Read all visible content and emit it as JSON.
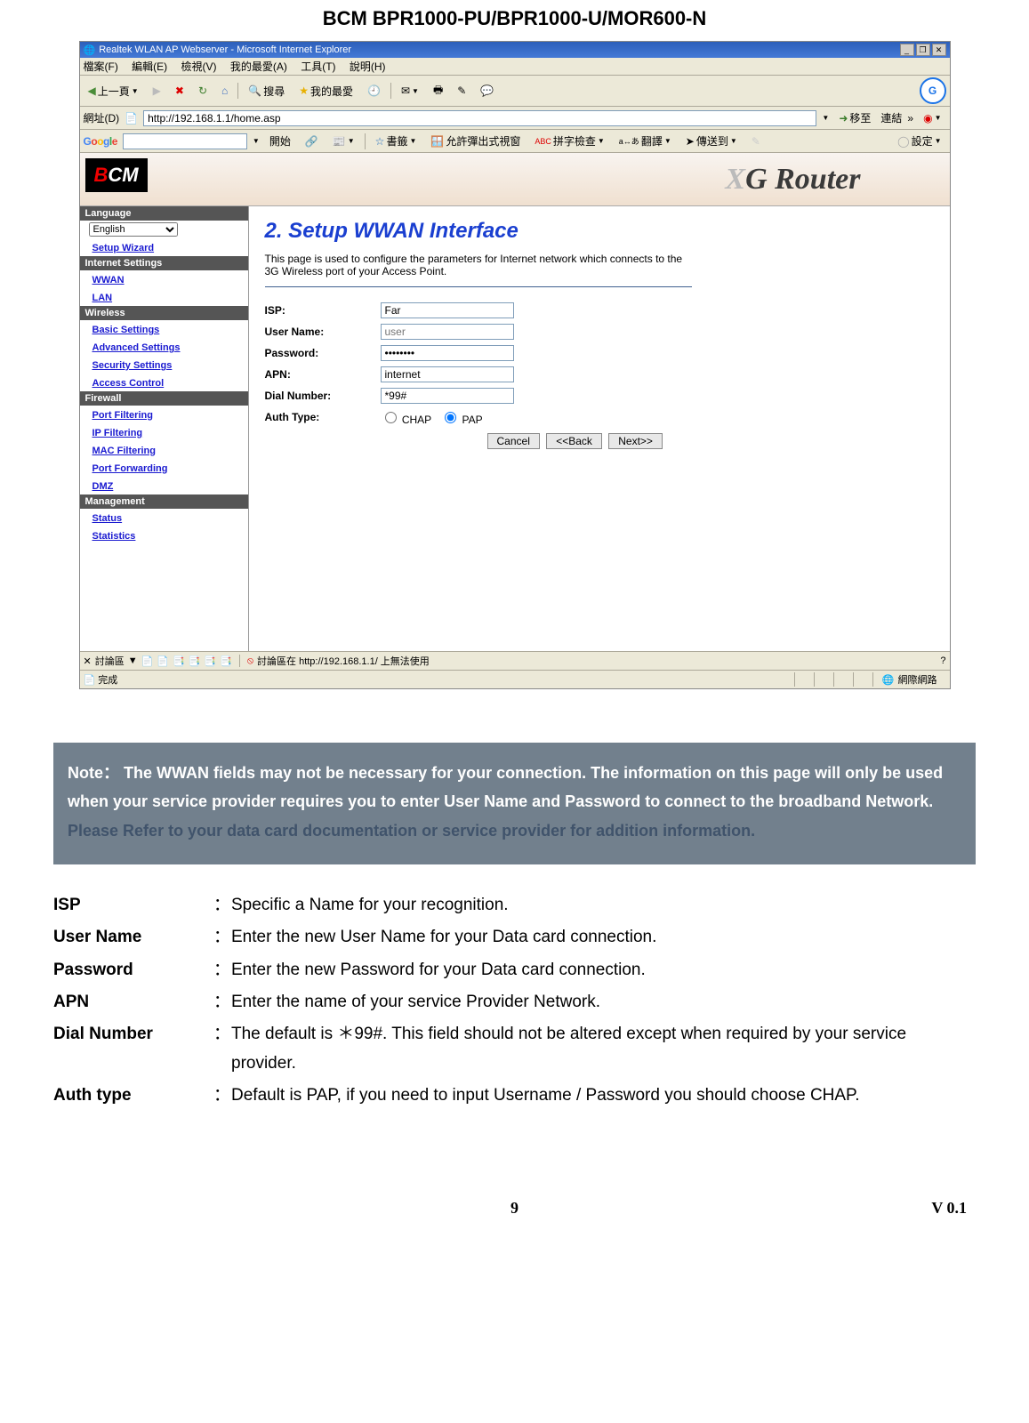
{
  "doc_title": "BCM    BPR1000-PU/BPR1000-U/MOR600-N",
  "browser": {
    "title": "Realtek WLAN AP Webserver - Microsoft Internet Explorer",
    "menus": [
      "檔案(F)",
      "編輯(E)",
      "檢視(V)",
      "我的最愛(A)",
      "工具(T)",
      "說明(H)"
    ],
    "toolbar": {
      "back": "上一頁",
      "search": "搜尋",
      "favorites": "我的最愛"
    },
    "address_label": "網址(D)",
    "address_value": "http://192.168.1.1/home.asp",
    "go": "移至",
    "links": "連結",
    "google": {
      "label": "Google",
      "start": "開始",
      "bookmarks": "書籤",
      "popup": "允許彈出式視窗",
      "spell": "拼字檢查",
      "translate": "翻譯",
      "sendto": "傳送到",
      "settings": "設定"
    }
  },
  "router": {
    "brand": "BCM",
    "banner": "XG Router",
    "sidebar": {
      "language_head": "Language",
      "language_value": "English",
      "setup_wizard": "Setup Wizard",
      "internet_head": "Internet Settings",
      "internet": [
        "WWAN",
        "LAN"
      ],
      "wireless_head": "Wireless",
      "wireless": [
        "Basic Settings",
        "Advanced Settings",
        "Security Settings",
        "Access Control"
      ],
      "firewall_head": "Firewall",
      "firewall": [
        "Port Filtering",
        "IP Filtering",
        "MAC Filtering",
        "Port Forwarding",
        "DMZ"
      ],
      "management_head": "Management",
      "management": [
        "Status",
        "Statistics"
      ]
    },
    "page": {
      "title": "2. Setup WWAN Interface",
      "desc": "This page is used to configure the parameters for Internet network which connects to the 3G Wireless port of your Access Point.",
      "fields": {
        "isp_label": "ISP:",
        "isp_value": "Far",
        "user_label": "User Name:",
        "user_placeholder": "user",
        "pw_label": "Password:",
        "pw_value": "••••••••",
        "apn_label": "APN:",
        "apn_value": "internet",
        "dial_label": "Dial Number:",
        "dial_value": "*99#",
        "auth_label": "Auth Type:",
        "auth_chap": "CHAP",
        "auth_pap": "PAP"
      },
      "buttons": {
        "cancel": "Cancel",
        "back": "<<Back",
        "next": "Next>>"
      }
    },
    "discussion": {
      "label": "討論區",
      "msg": "討論區在 http://192.168.1.1/ 上無法使用"
    },
    "status": {
      "done": "完成",
      "zone": "網際網路"
    }
  },
  "note": {
    "label": "Note：",
    "body1": "The WWAN fields may not be necessary for your connection. The information on this page will only be used when your service provider requires you to enter User Name and Password to connect to the broadband Network.",
    "hint": "Please Refer to your data card documentation or service provider for addition information."
  },
  "defs": [
    {
      "term": "ISP",
      "text": "Specific a Name for your recognition."
    },
    {
      "term": "User Name",
      "text": "Enter the new User Name for your Data card connection."
    },
    {
      "term": "Password",
      "text": "Enter the new Password for your Data card connection."
    },
    {
      "term": "APN",
      "text": "Enter the name of your service Provider Network."
    },
    {
      "term": "Dial Number",
      "text": "The default is ＊99#. This field should not be altered except when required by your service provider."
    },
    {
      "term": "Auth type",
      "text": "Default is PAP, if you need to input Username / Password you should choose CHAP."
    }
  ],
  "footer": {
    "page": "9",
    "version": "V 0.1"
  }
}
